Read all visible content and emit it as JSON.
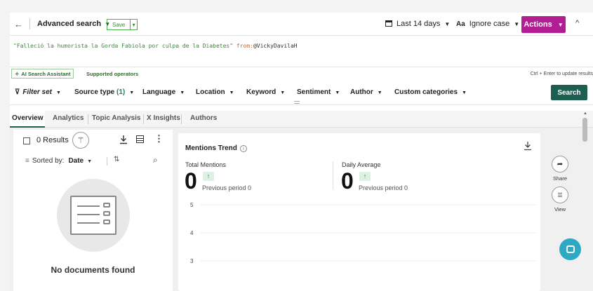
{
  "topbar": {
    "back_icon": "←",
    "title": "Advanced search",
    "save_label": "Save",
    "date_range": "Last 14 days",
    "case_icon": "Aa",
    "case_label": "Ignore case",
    "actions_label": "Actions",
    "collapse_icon": "^"
  },
  "query": {
    "string": "\"Falleció la humorista la Gorda Fabiola por culpa de la Diabetes\"",
    "operator": " from:",
    "value": "@VickyDavilaH"
  },
  "assist": {
    "label": "AI Search Assistant",
    "supported": "Supported operators",
    "hint": "Ctrl + Enter to update results"
  },
  "filters": {
    "filter_set": "Filter set",
    "source_type": "Source type",
    "source_count": "(1)",
    "language": "Language",
    "location": "Location",
    "keyword": "Keyword",
    "sentiment": "Sentiment",
    "author": "Author",
    "custom": "Custom categories",
    "search_label": "Search"
  },
  "tabs": [
    "Overview",
    "Analytics",
    "Topic Analysis",
    "X Insights",
    "Authors"
  ],
  "docs": {
    "results": "0 Results",
    "sorted_label": "Sorted by:",
    "sorted_value": "Date",
    "empty": "No documents found"
  },
  "trend": {
    "title": "Mentions Trend",
    "total_label": "Total Mentions",
    "total_value": "0",
    "avg_label": "Daily Average",
    "avg_value": "0",
    "prev": "Previous period 0",
    "up_icon": "↑"
  },
  "rail": {
    "share": "Share",
    "view": "View"
  },
  "chart_data": {
    "type": "line",
    "y_ticks": [
      5,
      4,
      3
    ],
    "series": []
  }
}
